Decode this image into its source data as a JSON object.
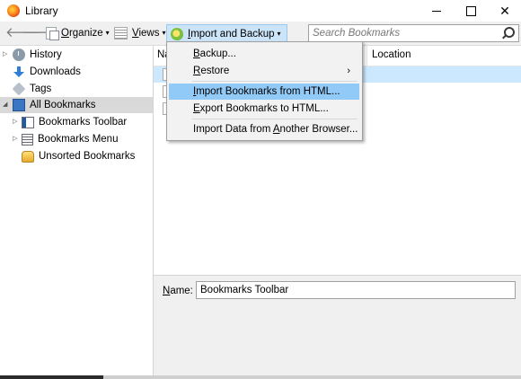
{
  "window": {
    "title": "Library"
  },
  "toolbar": {
    "organize_label": "Organize",
    "views_label": "Views",
    "import_label": "Import and Backup",
    "search_placeholder": "Search Bookmarks"
  },
  "sidebar": {
    "items": [
      {
        "label": "History"
      },
      {
        "label": "Downloads"
      },
      {
        "label": "Tags"
      },
      {
        "label": "All Bookmarks"
      },
      {
        "label": "Bookmarks Toolbar"
      },
      {
        "label": "Bookmarks Menu"
      },
      {
        "label": "Unsorted Bookmarks"
      }
    ]
  },
  "list": {
    "columns": [
      "Na",
      "Location"
    ]
  },
  "details": {
    "name_label": "Name:",
    "name_value": "Bookmarks Toolbar"
  },
  "menu": {
    "items": [
      {
        "label": "Backup...",
        "accesskey": "B",
        "rest": "ackup..."
      },
      {
        "label": "Restore",
        "accesskey": "R",
        "rest": "estore"
      },
      {
        "label": "Import Bookmarks from HTML...",
        "accesskey": "I",
        "rest": "mport Bookmarks from HTML..."
      },
      {
        "label": "Export Bookmarks to HTML...",
        "accesskey": "E",
        "rest": "xport Bookmarks to HTML..."
      },
      {
        "label": "Import Data from Another Browser...",
        "pre": "Import Data from ",
        "accesskey": "A",
        "rest": "nother Browser..."
      }
    ]
  },
  "colors": {
    "menu_highlight": "#91c9f7",
    "toolbar_active": "#cce4f7",
    "selection": "#d9d9d9"
  }
}
